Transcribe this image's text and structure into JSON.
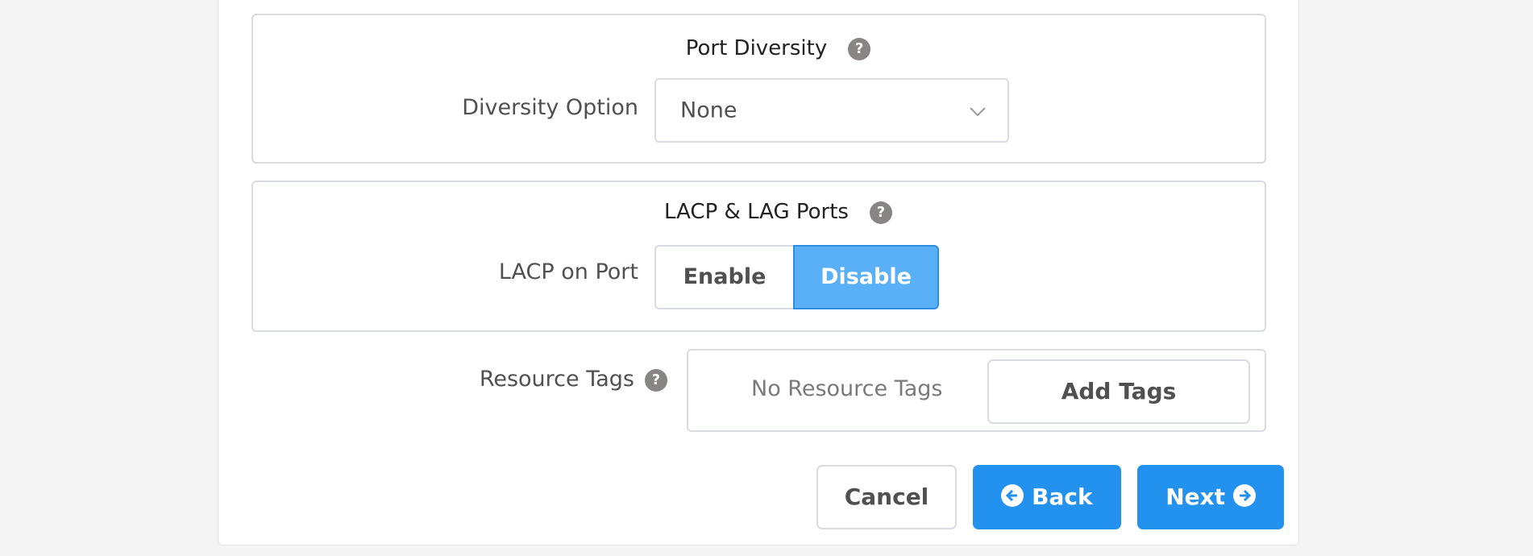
{
  "port_diversity": {
    "title": "Port Diversity",
    "help_icon": "question-circle-icon",
    "diversity_option_label": "Diversity Option",
    "diversity_option_value": "None"
  },
  "lacp": {
    "title": "LACP & LAG Ports",
    "help_icon": "question-circle-icon",
    "lacp_on_port_label": "LACP on Port",
    "enable_label": "Enable",
    "disable_label": "Disable",
    "selected": "Disable"
  },
  "resource_tags": {
    "label": "Resource Tags",
    "help_icon": "question-circle-icon",
    "empty_text": "No Resource Tags",
    "add_button_label": "Add Tags"
  },
  "footer": {
    "cancel_label": "Cancel",
    "back_label": "Back",
    "next_label": "Next"
  },
  "colors": {
    "primary": "#2391ee",
    "selected_segment": "#5ab0f6",
    "help_icon": "#8a8585",
    "border": "#d8dbe2"
  }
}
